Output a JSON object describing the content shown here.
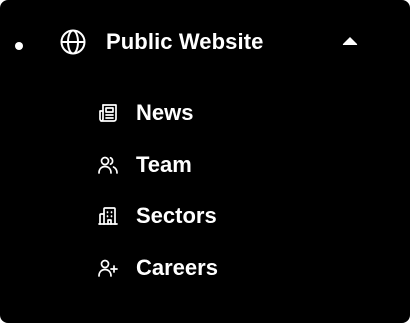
{
  "menu": {
    "header": {
      "label": "Public Website",
      "icon": "globe-icon",
      "expanded": true,
      "toggle_icon": "chevron-up-icon"
    },
    "items": [
      {
        "label": "News",
        "icon": "newspaper-icon"
      },
      {
        "label": "Team",
        "icon": "users-icon"
      },
      {
        "label": "Sectors",
        "icon": "building-icon"
      },
      {
        "label": "Careers",
        "icon": "user-plus-icon"
      }
    ]
  },
  "colors": {
    "background": "#000000",
    "text": "#ffffff",
    "page": "#ffffff"
  }
}
